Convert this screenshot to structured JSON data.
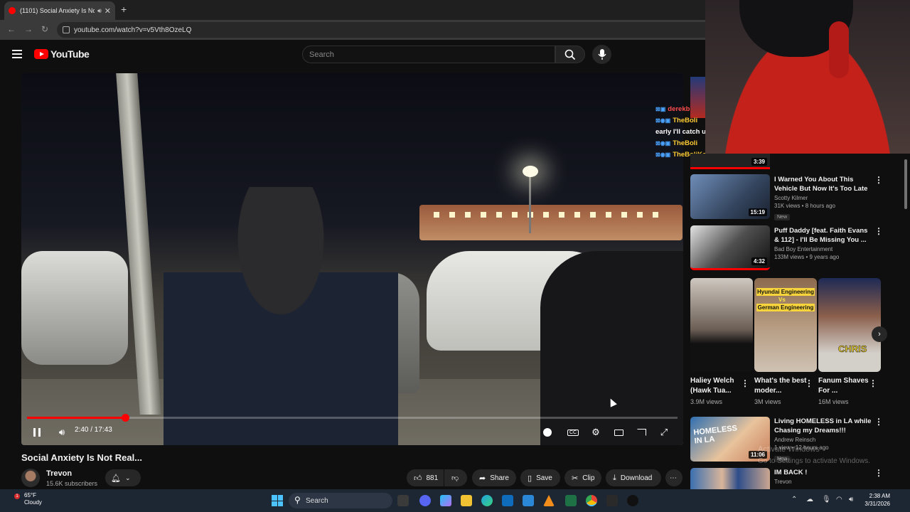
{
  "browser": {
    "tab_title": "(1101) Social Anxiety Is Not Real...",
    "new_tab_icon": "plus-icon",
    "url": "youtube.com/watch?v=v5Vth8OzeLQ"
  },
  "header": {
    "logo_text": "YouTube",
    "search_placeholder": "Search"
  },
  "player": {
    "time_display": "2:40 / 17:43",
    "progress": 0.151
  },
  "video": {
    "title": "Social Anxiety Is Not Real...",
    "channel_name": "Trevon",
    "subscribers": "15.6K subscribers",
    "like_count": "881",
    "share_label": "Share",
    "save_label": "Save",
    "clip_label": "Clip",
    "download_label": "Download"
  },
  "chat_overlay": [
    {
      "name": "derekb",
      "message": ""
    },
    {
      "name": "TheBoli",
      "message": ""
    },
    {
      "name": "",
      "message": "early I'll catch u"
    },
    {
      "name": "TheBoli",
      "message": ""
    },
    {
      "name": "TheBoliKenn",
      "message": ""
    }
  ],
  "sidebar": {
    "top_partial_duration": "3:39",
    "videos": [
      {
        "title": "I Warned You About This Vehicle But Now It's Too Late",
        "channel": "Scotty Kilmer",
        "meta": "31K views • 8 hours ago",
        "badge": "New",
        "duration": "15:19"
      },
      {
        "title": "Puff Daddy [feat. Faith Evans & 112] - I'll Be Missing You ...",
        "channel": "Bad Boy Entertainment",
        "meta": "133M views • 9 years ago",
        "badge": "",
        "duration": "4:32"
      },
      {
        "title": "Living HOMELESS in LA while Chasing my Dreams!!!",
        "channel": "Andrew Reinsch",
        "meta": "1 view • 12 hours ago",
        "badge": "New",
        "duration": "11:06"
      },
      {
        "title": "IM BACK !",
        "channel": "Trevon",
        "meta": "",
        "badge": "",
        "duration": ""
      }
    ],
    "shorts": [
      {
        "title": "Haliey Welch (Hawk Tua...",
        "views": "3.9M views"
      },
      {
        "title": "What's the best moder...",
        "views": "3M views"
      },
      {
        "title": "Fanum Shaves For ...",
        "views": "16M views"
      }
    ],
    "short_overlay_1": "Hyundai Engineering",
    "short_overlay_vs": "Vs",
    "short_overlay_2": "German Engineering",
    "short_overlay_3": "CHRIS",
    "homeless_thumb_text": "HOMELESS IN LA"
  },
  "watermark": {
    "line1": "Activate Windows",
    "line2": "Go to Settings to activate Windows."
  },
  "taskbar": {
    "temperature": "65°F",
    "weather": "Cloudy",
    "weather_badge": "1",
    "search_label": "Search",
    "time": "2:38 AM",
    "date": "3/31/2026"
  }
}
